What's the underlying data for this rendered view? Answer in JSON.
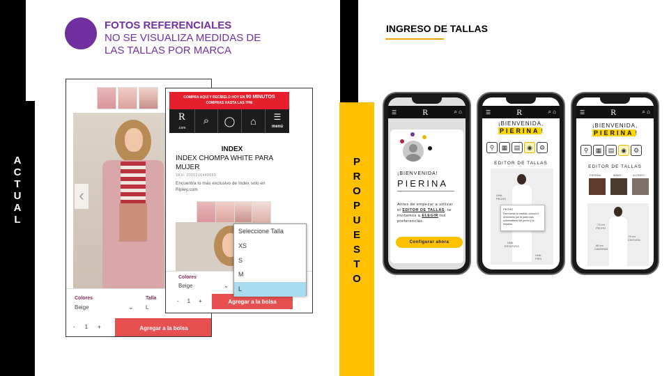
{
  "left": {
    "note_title": "FOTOS REFERENCIALES",
    "note_line1": "NO SE VISUALIZA MEDIDAS  DE",
    "note_line2": "LAS TALLAS POR MARCA",
    "side_label": [
      "A",
      "C",
      "T",
      "U",
      "A",
      "L"
    ],
    "back_shot": {
      "colors_label": "Colores",
      "colors_value": "Beige",
      "size_label": "Talla",
      "size_value": "L",
      "qty_minus": "-",
      "qty_value": "1",
      "qty_plus": "+",
      "add_button": "Agregar a la bolsa"
    },
    "front_shot": {
      "promo_line1": "COMPRA AQUÍ Y RECÍBELO HOY EN",
      "promo_highlight": "90 MINUTOS",
      "promo_line2": "COMPRAS HASTA LAS 7PM",
      "logo": "R",
      "logo_sub": ".com",
      "menu_label": "menú",
      "brand": "INDEX",
      "product_title": "INDEX CHOMPA WHITE PARA MUJER",
      "sku": "SKU: 2015216448650",
      "description": "Encuentra lo más exclusivo de Index solo en Ripley.com",
      "colors_label": "Colores",
      "colors_value": "Beige",
      "qty_minus": "-",
      "qty_value": "1",
      "qty_plus": "+",
      "add_button": "Agregar a la bolsa"
    },
    "dropdown": {
      "placeholder": "Seleccione Talla",
      "options": [
        "XS",
        "S",
        "M",
        "L"
      ],
      "selected": "L"
    }
  },
  "right": {
    "title": "INGRESO DE TALLAS",
    "side_label": [
      "P",
      "R",
      "O",
      "P",
      "U",
      "E",
      "S",
      "T",
      "O"
    ],
    "phone1": {
      "logo": "R",
      "welcome": "¡BIENVENIDA!",
      "name": "PIERINA",
      "text_pre": "Antes de empezar a utilizar el",
      "link1": "EDITOR DE TALLAS",
      "text_mid": ", te invitamos a",
      "link2": "ELEGIR",
      "text_post": "tus preferencias.",
      "button": "Configurar ahora"
    },
    "phone2": {
      "logo": "R",
      "welcome": "¡BIENVENIDA,",
      "name": "PIERINA",
      "excl": "!",
      "editor_title": "EDITOR DE TALLAS",
      "tooltip_title": "PECHO",
      "tooltip_text": "Para tomar la medida, coloca el centímetro por la parte más sobresaliente del pecho y la espalda.",
      "labels": [
        "UNA",
        "PECHO",
        "UNA",
        "ESTATURA",
        "UNA",
        "PIES"
      ]
    },
    "phone3": {
      "logo": "R",
      "welcome": "¡BIENVENIDA,",
      "name": "PIERINA",
      "excl": "!",
      "editor_title": "EDITOR DE TALLAS",
      "people": [
        "PIERINA",
        "MAMY",
        "ALONSO"
      ],
      "labels": [
        "73 cm",
        "PECHO",
        "73 cm",
        "CINTURA",
        "86 cm",
        "CADERAS"
      ]
    }
  }
}
